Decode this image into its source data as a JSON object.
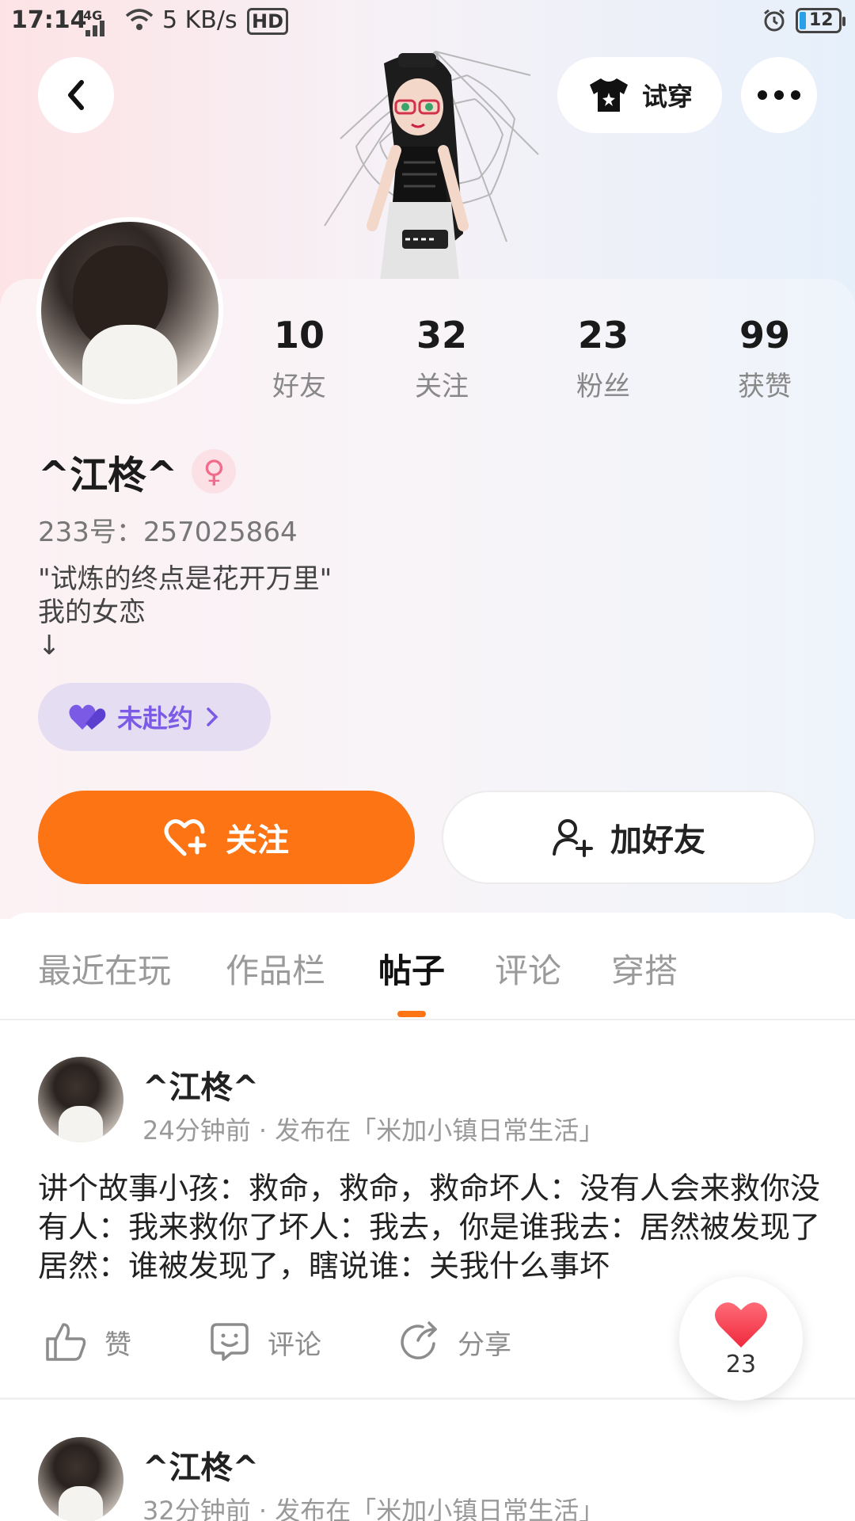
{
  "status_bar": {
    "time": "17:14",
    "network": "4G",
    "speed": "5 KB/s",
    "hd": "HD",
    "battery": "12"
  },
  "header": {
    "tryon_label": "试穿"
  },
  "profile": {
    "stats": [
      {
        "value": "10",
        "label": "好友"
      },
      {
        "value": "32",
        "label": "关注"
      },
      {
        "value": "23",
        "label": "粉丝"
      },
      {
        "value": "99",
        "label": "获赞"
      }
    ],
    "name": "^江柊^",
    "uid": "233号：257025864",
    "bio_lines": [
      "\"试炼的终点是花开万里\"",
      "我的女恋",
      "↓"
    ],
    "date_status": "未赴约"
  },
  "buttons": {
    "follow": "关注",
    "add_friend": "加好友"
  },
  "tabs": [
    "最近在玩",
    "作品栏",
    "帖子",
    "评论",
    "穿搭"
  ],
  "active_tab": "帖子",
  "posts": [
    {
      "author": "^江柊^",
      "meta": "24分钟前 · 发布在「米加小镇日常生活」",
      "body": "讲个故事小孩：救命，救命，救命坏人：没有人会来救你没有人：我来救你了坏人：我去，你是谁我去：居然被发现了居然：谁被发现了，瞎说谁：关我什么事坏",
      "actions": {
        "like": "赞",
        "comment": "评论",
        "share": "分享"
      }
    },
    {
      "author": "^江柊^",
      "meta": "32分钟前 · 发布在「米加小镇日常生活」"
    }
  ],
  "like_float": {
    "count": "23"
  },
  "colors": {
    "accent": "#fd7414",
    "date_pill_text": "#7b5be6",
    "gender_pink": "#f06b8c"
  }
}
